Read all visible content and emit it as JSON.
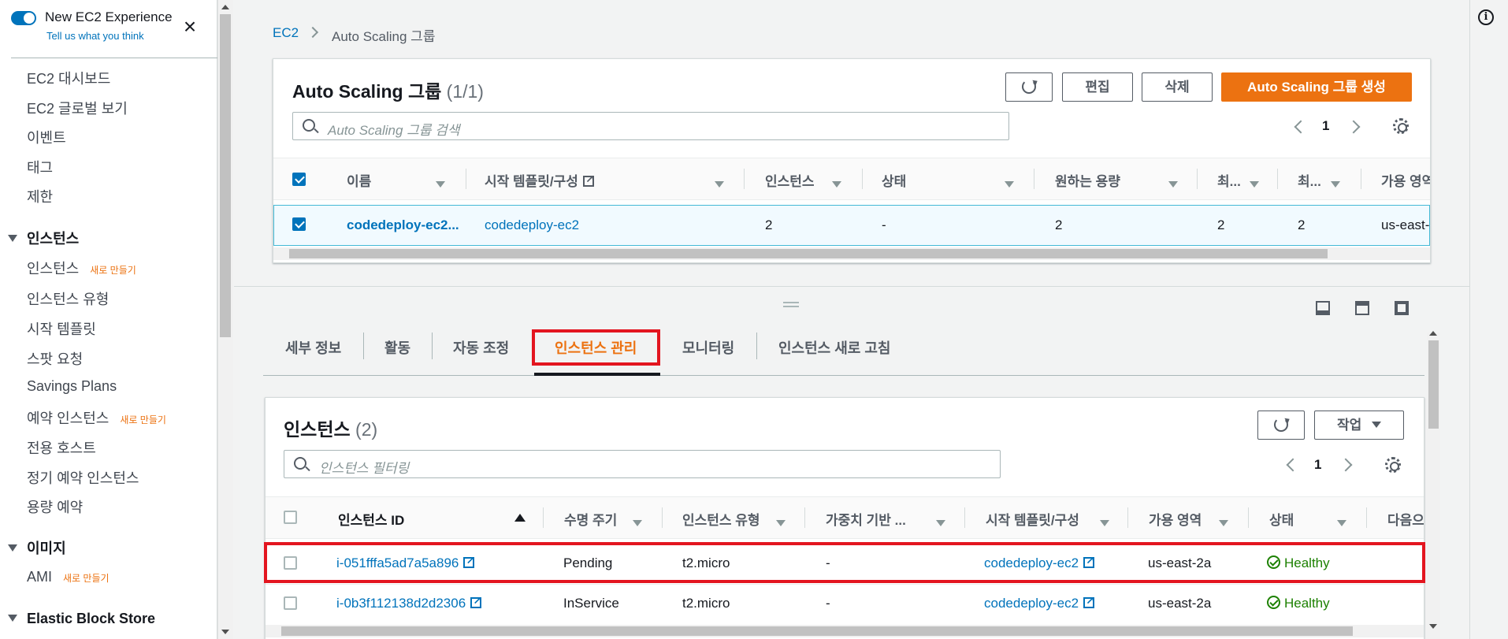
{
  "sidebar": {
    "experience_title": "New EC2 Experience",
    "experience_sub": "Tell us what you think",
    "items": [
      {
        "label": "EC2 대시보드"
      },
      {
        "label": "EC2 글로벌 보기"
      },
      {
        "label": "이벤트"
      },
      {
        "label": "태그"
      },
      {
        "label": "제한"
      }
    ],
    "sections": [
      {
        "label": "인스턴스",
        "items": [
          {
            "label": "인스턴스",
            "badge": "새로 만들기"
          },
          {
            "label": "인스턴스 유형"
          },
          {
            "label": "시작 템플릿"
          },
          {
            "label": "스팟 요청"
          },
          {
            "label": "Savings Plans"
          },
          {
            "label": "예약 인스턴스",
            "badge": "새로 만들기"
          },
          {
            "label": "전용 호스트"
          },
          {
            "label": "정기 예약 인스턴스"
          },
          {
            "label": "용량 예약"
          }
        ]
      },
      {
        "label": "이미지",
        "items": [
          {
            "label": "AMI",
            "badge": "새로 만들기"
          }
        ]
      },
      {
        "label": "Elastic Block Store",
        "items": []
      }
    ]
  },
  "breadcrumb": {
    "root": "EC2",
    "current": "Auto Scaling 그룹"
  },
  "asg": {
    "title": "Auto Scaling 그룹",
    "count": "(1/1)",
    "edit": "편집",
    "delete": "삭제",
    "create": "Auto Scaling 그룹 생성",
    "search_placeholder": "Auto Scaling 그룹 검색",
    "page": "1",
    "columns": [
      "이름",
      "시작 템플릿/구성",
      "인스턴스",
      "상태",
      "원하는 용량",
      "최...",
      "최...",
      "가용 영역"
    ],
    "row": {
      "name": "codedeploy-ec2...",
      "template": "codedeploy-ec2",
      "instances": "2",
      "status": "-",
      "desired": "2",
      "min": "2",
      "max": "2",
      "az": "us-east-..."
    }
  },
  "tabs": [
    "세부 정보",
    "활동",
    "자동 조정",
    "인스턴스 관리",
    "모니터링",
    "인스턴스 새로 고침"
  ],
  "instances": {
    "title": "인스턴스",
    "count": "(2)",
    "actions": "작업",
    "filter_placeholder": "인스턴스 필터링",
    "page": "1",
    "columns": [
      "인스턴스 ID",
      "수명 주기",
      "인스턴스 유형",
      "가중치 기반 ...",
      "시작 템플릿/구성",
      "가용 영역",
      "상태",
      "다음으"
    ],
    "rows": [
      {
        "id": "i-051fffa5ad7a5a896",
        "lifecycle": "Pending",
        "type": "t2.micro",
        "weight": "-",
        "template": "codedeploy-ec2",
        "az": "us-east-2a",
        "health": "Healthy"
      },
      {
        "id": "i-0b3f112138d2d2306",
        "lifecycle": "InService",
        "type": "t2.micro",
        "weight": "-",
        "template": "codedeploy-ec2",
        "az": "us-east-2a",
        "health": "Healthy"
      }
    ]
  },
  "info_icon": "i"
}
